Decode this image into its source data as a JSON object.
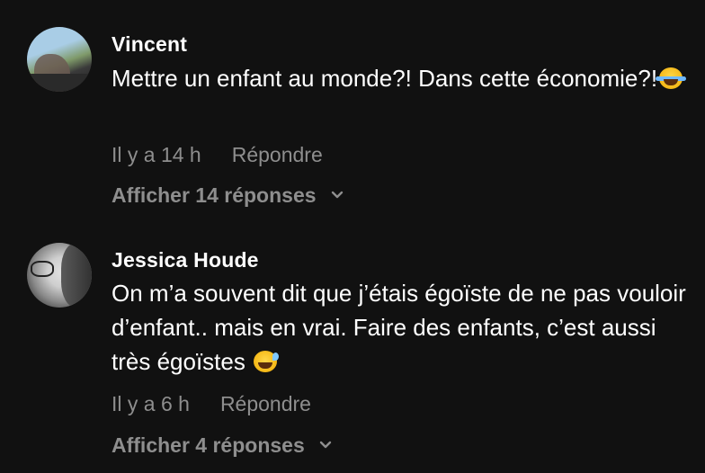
{
  "comments": [
    {
      "author": "Vincent",
      "text": "Mettre un enfant au monde?! Dans cette économie?!",
      "emoji": "face-with-tears-of-joy",
      "time": "Il y a 14 h",
      "reply_label": "Répondre",
      "view_replies_label": "Afficher 14 réponses"
    },
    {
      "author": "Jessica Houde",
      "text": "On m’a souvent dit que j’étais égoïste de ne pas vouloir d’enfant.. mais en vrai. Faire des enfants, c’est aussi très égoïstes",
      "emoji": "grinning-face-with-sweat",
      "time": "Il y a 6 h",
      "reply_label": "Répondre",
      "view_replies_label": "Afficher 4 réponses"
    }
  ],
  "colors": {
    "background": "#111111",
    "text_primary": "#ffffff",
    "text_secondary": "#8e8e8e"
  }
}
